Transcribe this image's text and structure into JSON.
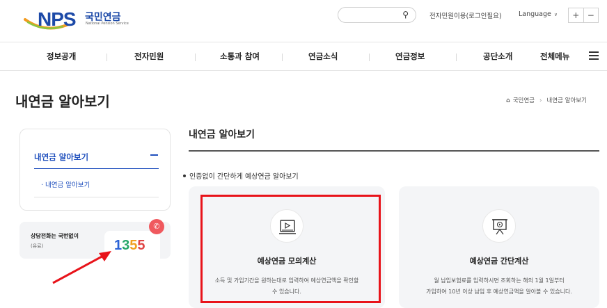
{
  "header": {
    "logo": {
      "text": "NPS",
      "korean": "국민연금",
      "english": "National Pension Service"
    },
    "search": {
      "placeholder": ""
    },
    "links": {
      "e_service": "전자민원이용(로그인필요)",
      "language": "Language"
    },
    "zoom": {
      "plus": "+",
      "minus": "−"
    }
  },
  "gnb": {
    "items": [
      "정보공개",
      "전자민원",
      "소통과 참여",
      "연금소식",
      "연금정보",
      "공단소개"
    ],
    "full_menu": "전체메뉴"
  },
  "page": {
    "title": "내연금 알아보기",
    "breadcrumb": [
      "국민연금",
      "내연금 알아보기"
    ]
  },
  "sidebar": {
    "title": "내연금 알아보기",
    "sub_item": "· 내연금 알아보기",
    "call": {
      "label": "상담전화는 국번없이",
      "note": "(유료)",
      "number": [
        "1",
        "3",
        "5",
        "5"
      ]
    }
  },
  "main": {
    "title": "내연금 알아보기",
    "subtitle": "인증없이 간단하게 예상연금 알아보기",
    "cards": [
      {
        "icon": "video-player-icon",
        "title": "예상연금 모의계산",
        "desc_line1": "소득 및 가입기간을 원하는대로 입력하여 예상연금액을 확인할",
        "desc_line2": "수 있습니다."
      },
      {
        "icon": "presentation-screen-icon",
        "title": "예상연금 간단계산",
        "desc_line1": "월 납입보험료를 입력하시면 조회하는 해의 1월 1일부터",
        "desc_line2": "가입하여 10년 이상 납입 후 예상연금액을 알아볼 수 있습니다."
      }
    ]
  },
  "colors": {
    "brand_blue": "#1d4aa8",
    "sidebar_blue": "#1f4fbd",
    "highlight_red": "#e8131a",
    "number_blue": "#2b63d6",
    "number_green": "#26a66b",
    "number_orange": "#f0a020",
    "number_red": "#e04545"
  }
}
